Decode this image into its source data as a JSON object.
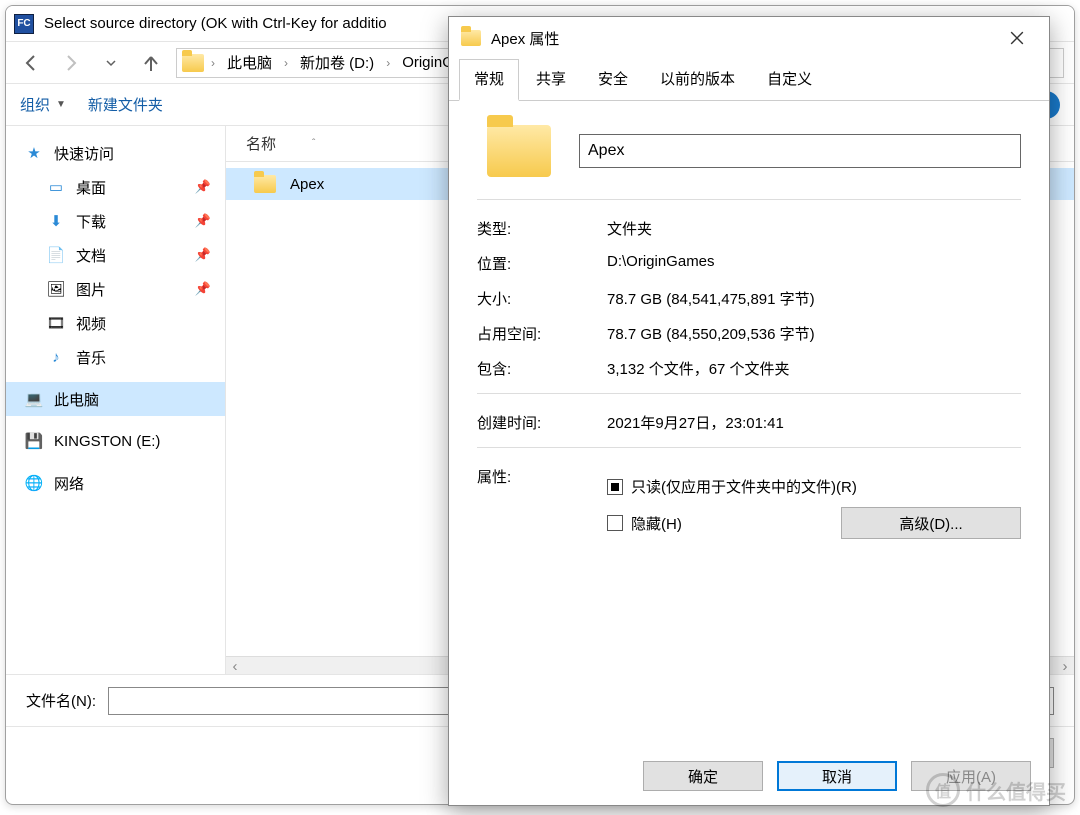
{
  "window": {
    "title": "Select source directory (OK with Ctrl-Key for additio",
    "app_icon_text": "FC"
  },
  "breadcrumb": {
    "items": [
      "此电脑",
      "新加卷 (D:)",
      "OriginG"
    ]
  },
  "toolbar": {
    "organize": "组织",
    "new_folder": "新建文件夹"
  },
  "sidebar": {
    "quick_access": "快速访问",
    "desktop": "桌面",
    "downloads": "下载",
    "documents": "文档",
    "pictures": "图片",
    "videos": "视频",
    "music": "音乐",
    "this_pc": "此电脑",
    "drive_e": "KINGSTON (E:)",
    "network": "网络"
  },
  "list": {
    "col_name": "名称",
    "rows": [
      "Apex"
    ]
  },
  "filebar": {
    "label": "文件名(N):",
    "value": ""
  },
  "footer": {
    "ok": "确定",
    "cancel": "取消",
    "apply": "应用(A)"
  },
  "props": {
    "title": "Apex 属性",
    "tabs": [
      "常规",
      "共享",
      "安全",
      "以前的版本",
      "自定义"
    ],
    "name_value": "Apex",
    "rows": {
      "type_k": "类型:",
      "type_v": "文件夹",
      "loc_k": "位置:",
      "loc_v": "D:\\OriginGames",
      "size_k": "大小:",
      "size_v": "78.7 GB (84,541,475,891 字节)",
      "ondisk_k": "占用空间:",
      "ondisk_v": "78.7 GB (84,550,209,536 字节)",
      "contains_k": "包含:",
      "contains_v": "3,132 个文件，67 个文件夹",
      "created_k": "创建时间:",
      "created_v": "2021年9月27日，23:01:41",
      "attr_k": "属性:",
      "readonly": "只读(仅应用于文件夹中的文件)(R)",
      "hidden": "隐藏(H)",
      "advanced": "高级(D)..."
    }
  },
  "watermark": {
    "badge": "值",
    "text": "什么值得买"
  }
}
